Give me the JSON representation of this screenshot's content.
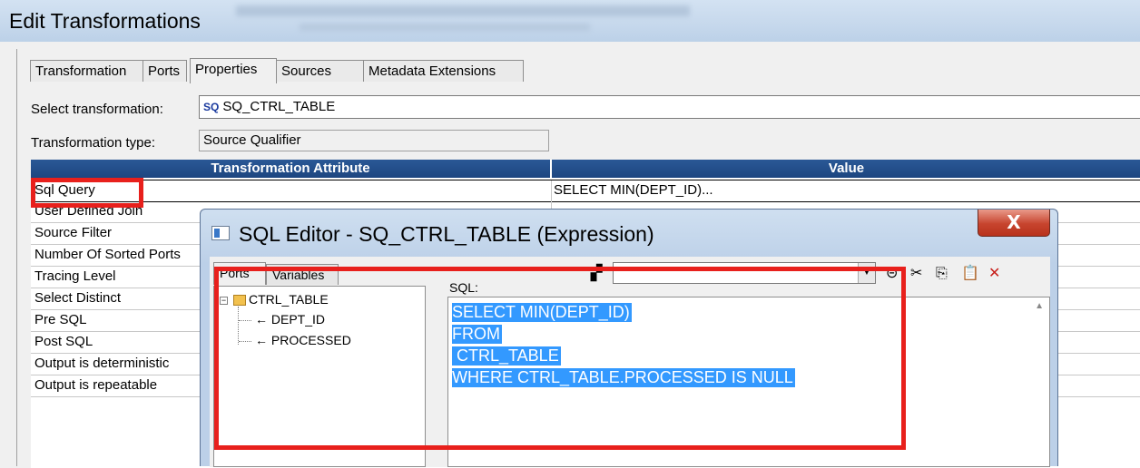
{
  "window": {
    "title": "Edit Transformations"
  },
  "tabs": [
    "Transformation",
    "Ports",
    "Properties",
    "Sources",
    "Metadata Extensions"
  ],
  "active_tab": "Properties",
  "form": {
    "select_label": "Select transformation:",
    "select_badge": "SQ",
    "select_value": "SQ_CTRL_TABLE",
    "type_label": "Transformation type:",
    "type_value": "Source Qualifier"
  },
  "grid": {
    "headers": [
      "Transformation Attribute",
      "Value"
    ],
    "rows": [
      {
        "attr": "Sql Query",
        "value": "SELECT MIN(DEPT_ID)..."
      },
      {
        "attr": "User Defined Join",
        "value": ""
      },
      {
        "attr": "Source Filter",
        "value": ""
      },
      {
        "attr": "Number Of Sorted Ports",
        "value": ""
      },
      {
        "attr": "Tracing Level",
        "value": ""
      },
      {
        "attr": "Select Distinct",
        "value": ""
      },
      {
        "attr": "Pre SQL",
        "value": ""
      },
      {
        "attr": "Post SQL",
        "value": ""
      },
      {
        "attr": "Output is deterministic",
        "value": ""
      },
      {
        "attr": "Output is repeatable",
        "value": ""
      }
    ]
  },
  "dialog": {
    "title": "SQL Editor - SQ_CTRL_TABLE (Expression)",
    "close": "X",
    "left_tabs": [
      "Ports",
      "Variables"
    ],
    "tree": {
      "root": "CTRL_TABLE",
      "children": [
        "DEPT_ID",
        "PROCESSED"
      ]
    },
    "sql_label": "SQL:",
    "sql_lines": [
      "SELECT MIN(DEPT_ID)",
      "FROM",
      " CTRL_TABLE",
      "WHERE CTRL_TABLE.PROCESSED IS NULL"
    ]
  },
  "colors": {
    "header_blue": "#1d4680",
    "selection_blue": "#3399ff",
    "highlight_red": "#e8201c",
    "close_red": "#c7442e"
  },
  "icons": [
    "sq-icon",
    "table-icon",
    "binoculars-icon",
    "cut-icon",
    "copy-icon",
    "paste-icon",
    "delete-icon",
    "close-icon",
    "window-icon"
  ]
}
